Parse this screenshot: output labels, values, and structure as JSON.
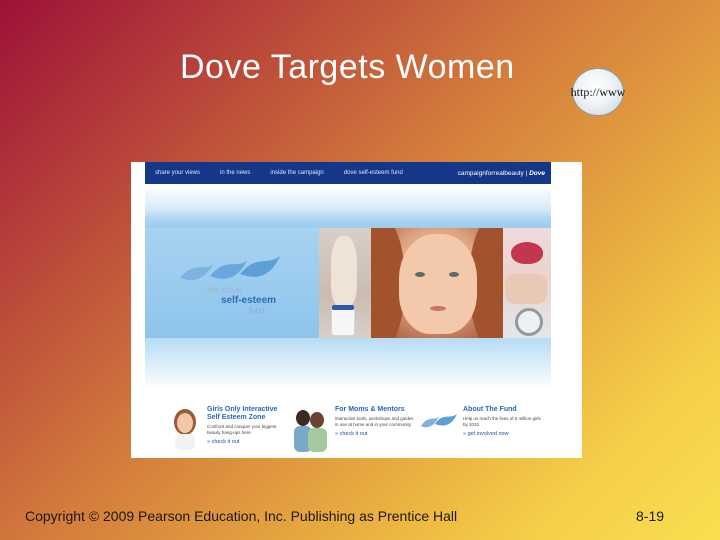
{
  "slide": {
    "title": "Dove Targets Women",
    "badge_text": "http://www",
    "copyright": "Copyright © 2009 Pearson Education, Inc.  Publishing as Prentice Hall",
    "page_number": "8-19"
  },
  "website": {
    "nav": [
      "share your views",
      "in the news",
      "inside the campaign",
      "dove self-esteem fund"
    ],
    "brand": "campaignforrealbeauty",
    "brand_mark": "Dove",
    "fund_logo": {
      "line1": "the dove",
      "line2": "self-esteem",
      "line3": "fund"
    },
    "promos": [
      {
        "title": "Girls Only Interactive Self Esteem Zone",
        "text": "Confront and conquer your biggest beauty hang-ups here",
        "link": "» check it out"
      },
      {
        "title": "For Moms & Mentors",
        "text": "interactive tools, workshops and guides in use at home and in your community",
        "link": "» check it out"
      },
      {
        "title": "About The Fund",
        "text": "Help us reach the lives of 5 million girls by 2010",
        "link": "» get involved now"
      }
    ]
  },
  "colors": {
    "nav_bg": "#15378a",
    "promo_title": "#2a63c0",
    "slide_text": "#ffffff"
  },
  "icons": [
    "http-globe-icon",
    "dove-birds-icon"
  ]
}
